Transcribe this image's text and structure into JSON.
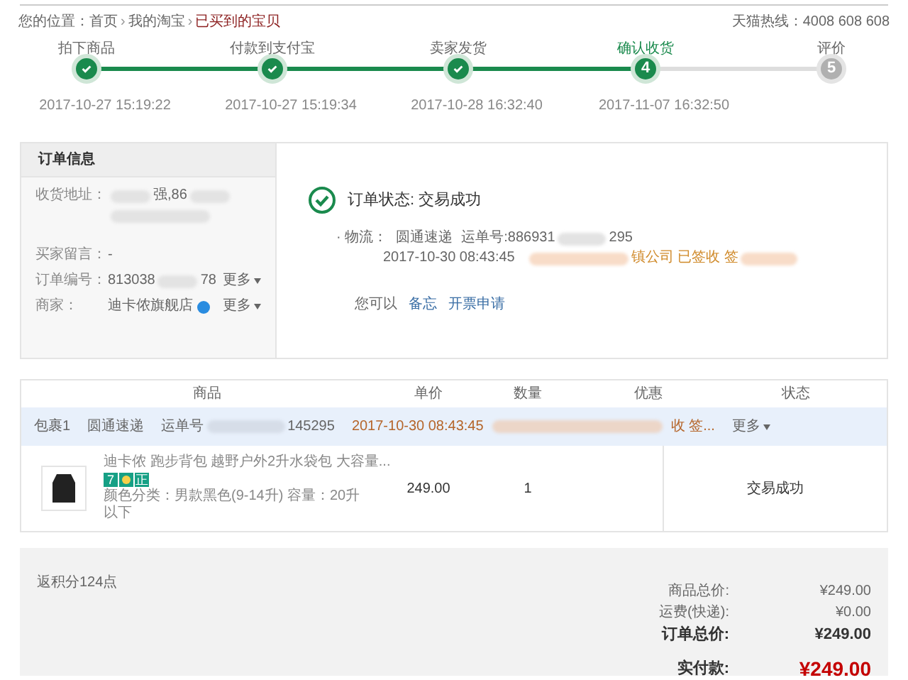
{
  "breadcrumb": {
    "label": "您的位置：",
    "separator": "›",
    "items": [
      {
        "text": "首页",
        "current": false
      },
      {
        "text": "我的淘宝",
        "current": false
      },
      {
        "text": "已买到的宝贝",
        "current": true
      }
    ]
  },
  "hotline": "天猫热线：4008 608 608",
  "steps": [
    {
      "label": "拍下商品",
      "done": true,
      "current": false,
      "time": "2017-10-27 15:19:22"
    },
    {
      "label": "付款到支付宝",
      "done": true,
      "current": false,
      "time": "2017-10-27 15:19:34"
    },
    {
      "label": "卖家发货",
      "done": true,
      "current": false,
      "time": "2017-10-28 16:32:40"
    },
    {
      "label": "确认收货",
      "done": false,
      "current": true,
      "number": "4",
      "time": "2017-11-07 16:32:50"
    },
    {
      "label": "评价",
      "done": false,
      "current": false,
      "number": "5"
    }
  ],
  "order_info": {
    "title": "订单信息",
    "rows": [
      {
        "label": "收货地址：",
        "segments": [
          {
            "kind": "blur"
          },
          {
            "kind": "text",
            "text": "强,86"
          },
          {
            "kind": "blur"
          },
          {
            "kind": "blur_line"
          }
        ]
      },
      {
        "label": "买家留言：",
        "segments": [
          {
            "kind": "text",
            "text": "-"
          }
        ]
      },
      {
        "label": "订单编号：",
        "segments": [
          {
            "kind": "text",
            "text": "813038"
          },
          {
            "kind": "blur"
          },
          {
            "kind": "text",
            "text": "78"
          }
        ],
        "more": "更多"
      },
      {
        "label": "商家：",
        "segments": [
          {
            "kind": "text",
            "text": "迪卡侬旗舰店"
          }
        ],
        "badge": true,
        "more": "更多"
      }
    ]
  },
  "status": {
    "title": "订单状态: 交易成功",
    "logistics_label": "· 物流：",
    "carrier": "圆通速递",
    "waybill": [
      "运单号:886931",
      "295"
    ],
    "time": "2017-10-30 08:43:45",
    "detail": "镇公司 已签收 签",
    "actions_label": "您可以",
    "actions": [
      "备忘",
      "开票申请"
    ]
  },
  "table": {
    "columns": [
      "商品",
      "单价",
      "数量",
      "优惠",
      "状态"
    ],
    "package": {
      "name": "包裹1",
      "carrier": "圆通速递",
      "waybill": [
        "运单号",
        "145295"
      ],
      "time": "2017-10-30 08:43:45",
      "detail": "收 签...",
      "more": "更多"
    },
    "rows": [
      {
        "title": "迪卡侬 跑步背包 越野户外2升水袋包 大容量...",
        "badges": [
          {
            "kind": "text",
            "text": "7"
          },
          {
            "kind": "icon"
          },
          {
            "kind": "text",
            "text": "正"
          }
        ],
        "sku": "颜色分类：男款黑色(9-14升)  容量：20升以下",
        "price": "249.00",
        "quantity": "1",
        "status": "交易成功"
      }
    ]
  },
  "summary": {
    "points": "返积分124点",
    "lines": [
      {
        "label": "商品总价:",
        "value": "¥249.00",
        "kind": "normal"
      },
      {
        "label": "运费(快递):",
        "value": "¥0.00",
        "kind": "normal"
      },
      {
        "label": "订单总价:",
        "value": "¥249.00",
        "kind": "bold"
      },
      {
        "label": "实付款:",
        "value": "¥249.00",
        "kind": "pay"
      }
    ]
  }
}
